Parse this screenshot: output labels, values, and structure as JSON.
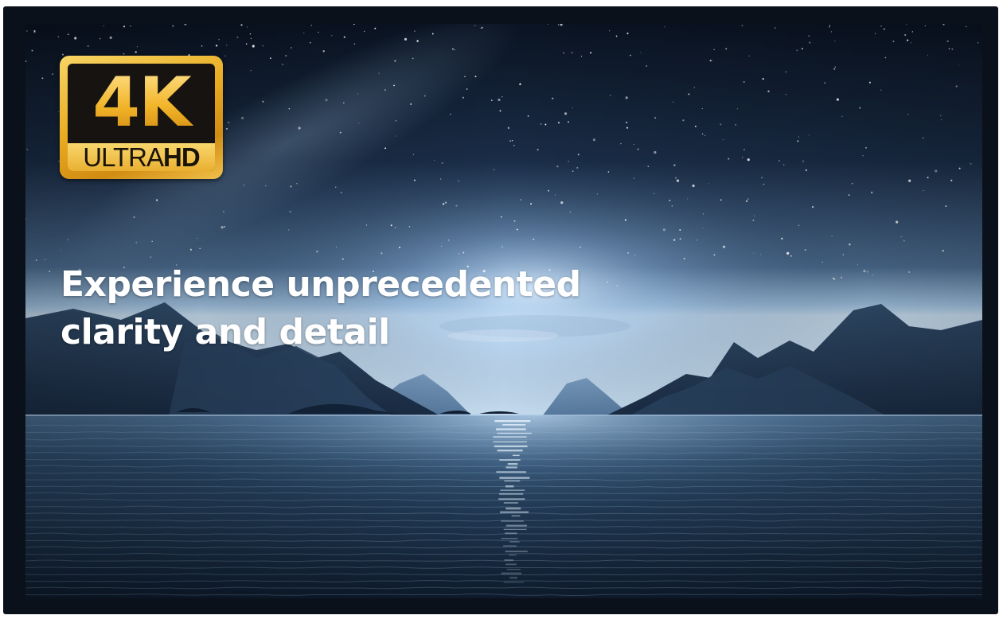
{
  "badge": {
    "resolution": "4K",
    "ultra": "ULTRA",
    "hd": "HD"
  },
  "headline": {
    "line1": "Experience unprecedented",
    "line2": "clarity and detail"
  },
  "colors": {
    "frame": "#0b111b",
    "badge_gold": "#e9ac21",
    "headline": "#ffffff"
  }
}
